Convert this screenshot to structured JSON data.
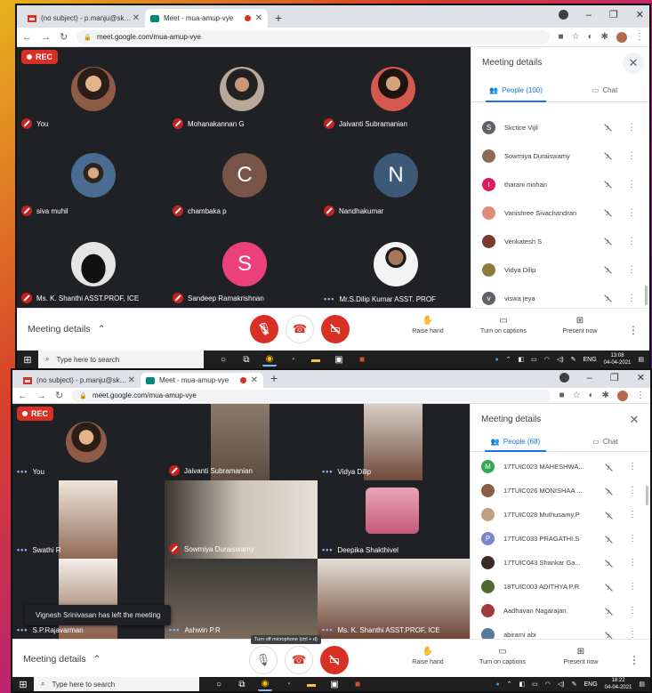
{
  "screens": [
    {
      "tabs": [
        {
          "title": "(no subject) - p.manju@skct.edu.in"
        },
        {
          "title": "Meet - mua-amup-vye"
        }
      ],
      "url": "meet.google.com/mua-amup-vye",
      "rec_label": "REC",
      "tiles": [
        {
          "name": "You",
          "initial": ""
        },
        {
          "name": "Mohanakannan G",
          "initial": ""
        },
        {
          "name": "Jaivanti Subramanian",
          "initial": ""
        },
        {
          "name": "siva muhil",
          "initial": ""
        },
        {
          "name": "chambaka p",
          "initial": "C"
        },
        {
          "name": "Nandhakumar",
          "initial": "N"
        },
        {
          "name": "Ms. K. Shanthi ASST.PROF, ICE",
          "initial": ""
        },
        {
          "name": "Sandeep Ramakrishnan",
          "initial": "S"
        },
        {
          "name": "Mr.S.Dilip Kumar ASST. PROF",
          "initial": ""
        }
      ],
      "panel": {
        "title": "Meeting details",
        "people_tab": "People (100)",
        "chat_tab": "Chat",
        "people": [
          {
            "name": "Skctice Vijil",
            "initial": "S",
            "color": "#5f6368"
          },
          {
            "name": "Sowmiya Duraiswamy",
            "initial": "",
            "color": "#8e6b50"
          },
          {
            "name": "tharani mohan",
            "initial": "t",
            "color": "#d81b60"
          },
          {
            "name": "Vanishree Sivachandran",
            "initial": "",
            "color": "#e08a7a"
          },
          {
            "name": "Venkatesh S",
            "initial": "",
            "color": "#7a3b2e"
          },
          {
            "name": "Vidya Dilip",
            "initial": "",
            "color": "#8b7a3a"
          },
          {
            "name": "viswa jeya",
            "initial": "v",
            "color": "#5f6368"
          }
        ]
      },
      "bottom": {
        "meeting_details": "Meeting details",
        "raise_hand": "Raise hand",
        "captions": "Turn on captions",
        "present": "Present now"
      },
      "taskbar": {
        "search": "Type here to search",
        "lang": "ENG",
        "time": "13:08",
        "date": "04-04-2021"
      }
    },
    {
      "tabs": [
        {
          "title": "(no subject) - p.manju@skct.edu.in"
        },
        {
          "title": "Meet - mua-amup-vye"
        }
      ],
      "url": "meet.google.com/mua-amup-vye",
      "rec_label": "REC",
      "tiles": [
        {
          "name": "You"
        },
        {
          "name": "Jaivanti Subramanian"
        },
        {
          "name": "Vidya Dilip"
        },
        {
          "name": "Swathi R"
        },
        {
          "name": "Sowmiya Duraiswamy"
        },
        {
          "name": "Deepika Shakthivel"
        },
        {
          "name": "S.P.Rajavarman"
        },
        {
          "name": "Ashwin P.R"
        },
        {
          "name": "Ms. K. Shanthi ASST.PROF, ICE"
        }
      ],
      "toast": "Vignesh Srinivasan has left the meeting",
      "tooltip": "Turn off microphone (ctrl + d)",
      "panel": {
        "title": "Meeting details",
        "people_tab": "People (68)",
        "chat_tab": "Chat",
        "people": [
          {
            "name": "17TUIC023 MAHESHWA...",
            "initial": "M",
            "color": "#33a852"
          },
          {
            "name": "17TUIC026 MONISHAA ...",
            "initial": "",
            "color": "#8e5b46"
          },
          {
            "name": "17TUIC028 Muthusamy.P",
            "initial": "",
            "color": "#c0a080"
          },
          {
            "name": "17TUIC033 PRAGATHI.S",
            "initial": "P",
            "color": "#7986cb"
          },
          {
            "name": "17TUIC043 Shankar Ga...",
            "initial": "",
            "color": "#3a2a24"
          },
          {
            "name": "18TUIC003 ADITHYA P.R",
            "initial": "",
            "color": "#4e6b2e"
          },
          {
            "name": "Aadhavan Nagarajan",
            "initial": "",
            "color": "#a33a3a"
          },
          {
            "name": "abirami abi",
            "initial": "",
            "color": "#5a7a9a"
          }
        ]
      },
      "bottom": {
        "meeting_details": "Meeting details",
        "raise_hand": "Raise hand",
        "captions": "Turn on captions",
        "present": "Present now"
      },
      "taskbar": {
        "search": "Type here to search",
        "lang": "ENG",
        "time": "18:22",
        "date": "04-04-2021"
      }
    }
  ]
}
